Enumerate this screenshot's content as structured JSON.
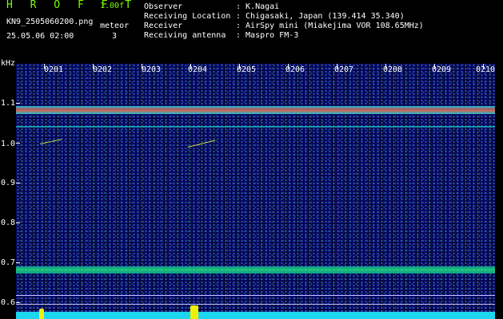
{
  "header": {
    "brand": "H R O F F T",
    "version": "1.00f",
    "filename": "KN9_2505060200.png",
    "meteor_label": "meteor",
    "datetime": "25.05.06 02:00",
    "meteor_count": "3"
  },
  "info": [
    {
      "label": "Observer",
      "value": ": K.Nagai"
    },
    {
      "label": "Receiving Location",
      "value": ": Chigasaki, Japan (139.414 35.340)"
    },
    {
      "label": "Receiver",
      "value": ": AirSpy mini (Miakejima VOR 108.65MHz)"
    },
    {
      "label": "Receiving antenna",
      "value": ": Maspro FM-3"
    }
  ],
  "spectrogram": {
    "unit_label": "kHz",
    "time_labels": [
      "0201",
      "0202",
      "0203",
      "0204",
      "0205",
      "0206",
      "0207",
      "0208",
      "0209",
      "0210"
    ],
    "freq_labels": [
      "1.1",
      "1.0",
      "0.9",
      "0.8",
      "0.7",
      "0.6"
    ],
    "colors": {
      "background": "#0a0a6a",
      "band_main": "#e07050",
      "band_low": "#20e080",
      "strip": "#1cd6f0",
      "spike": "#f0f000"
    }
  }
}
